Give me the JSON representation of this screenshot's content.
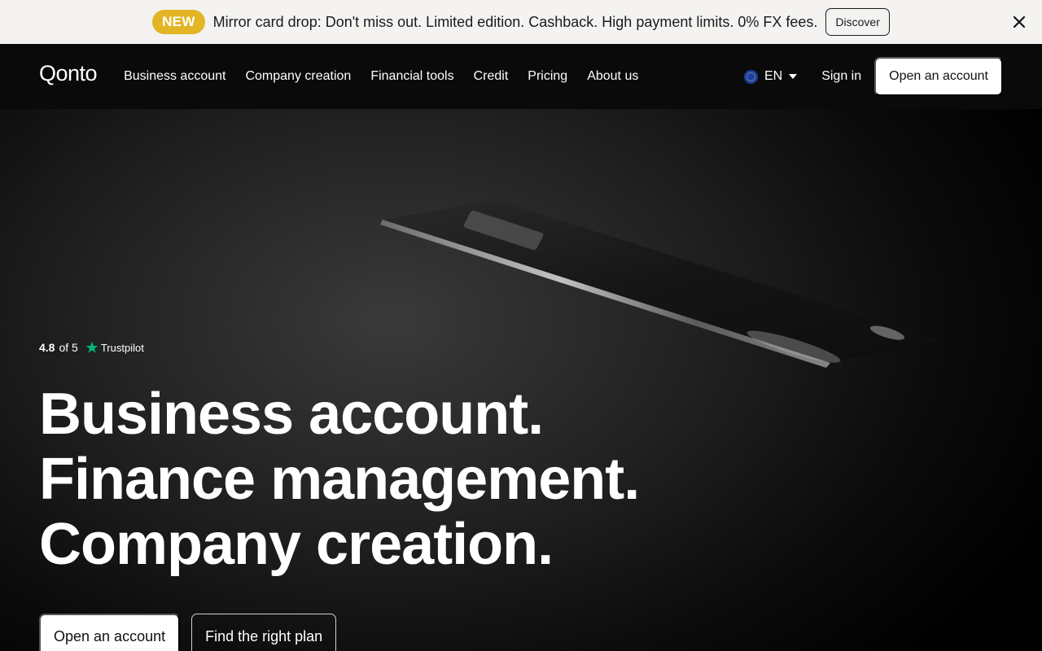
{
  "banner": {
    "badge": "NEW",
    "text": "Mirror card drop: Don't miss out. Limited edition. Cashback. High payment limits. 0% FX fees.",
    "discover_label": "Discover"
  },
  "nav": {
    "logo": "Qonto",
    "links": [
      "Business account",
      "Company creation",
      "Financial tools",
      "Credit",
      "Pricing",
      "About us"
    ],
    "language": "EN",
    "sign_in": "Sign in",
    "open_account": "Open an account"
  },
  "hero": {
    "rating_score": "4.8",
    "rating_suffix": "of 5",
    "rating_source": "Trustpilot",
    "headline": [
      "Business account.",
      "Finance management.",
      "Company creation."
    ],
    "cta_primary": "Open an account",
    "cta_secondary": "Find the right plan"
  },
  "colors": {
    "banner_bg": "#f4f3f1",
    "badge": "#e3b424",
    "trustpilot_star": "#00b67a",
    "nav_bg": "#0a0a0a"
  },
  "icons": [
    "close-icon",
    "chevron-down-icon",
    "eu-flag-icon",
    "trustpilot-star-icon"
  ]
}
